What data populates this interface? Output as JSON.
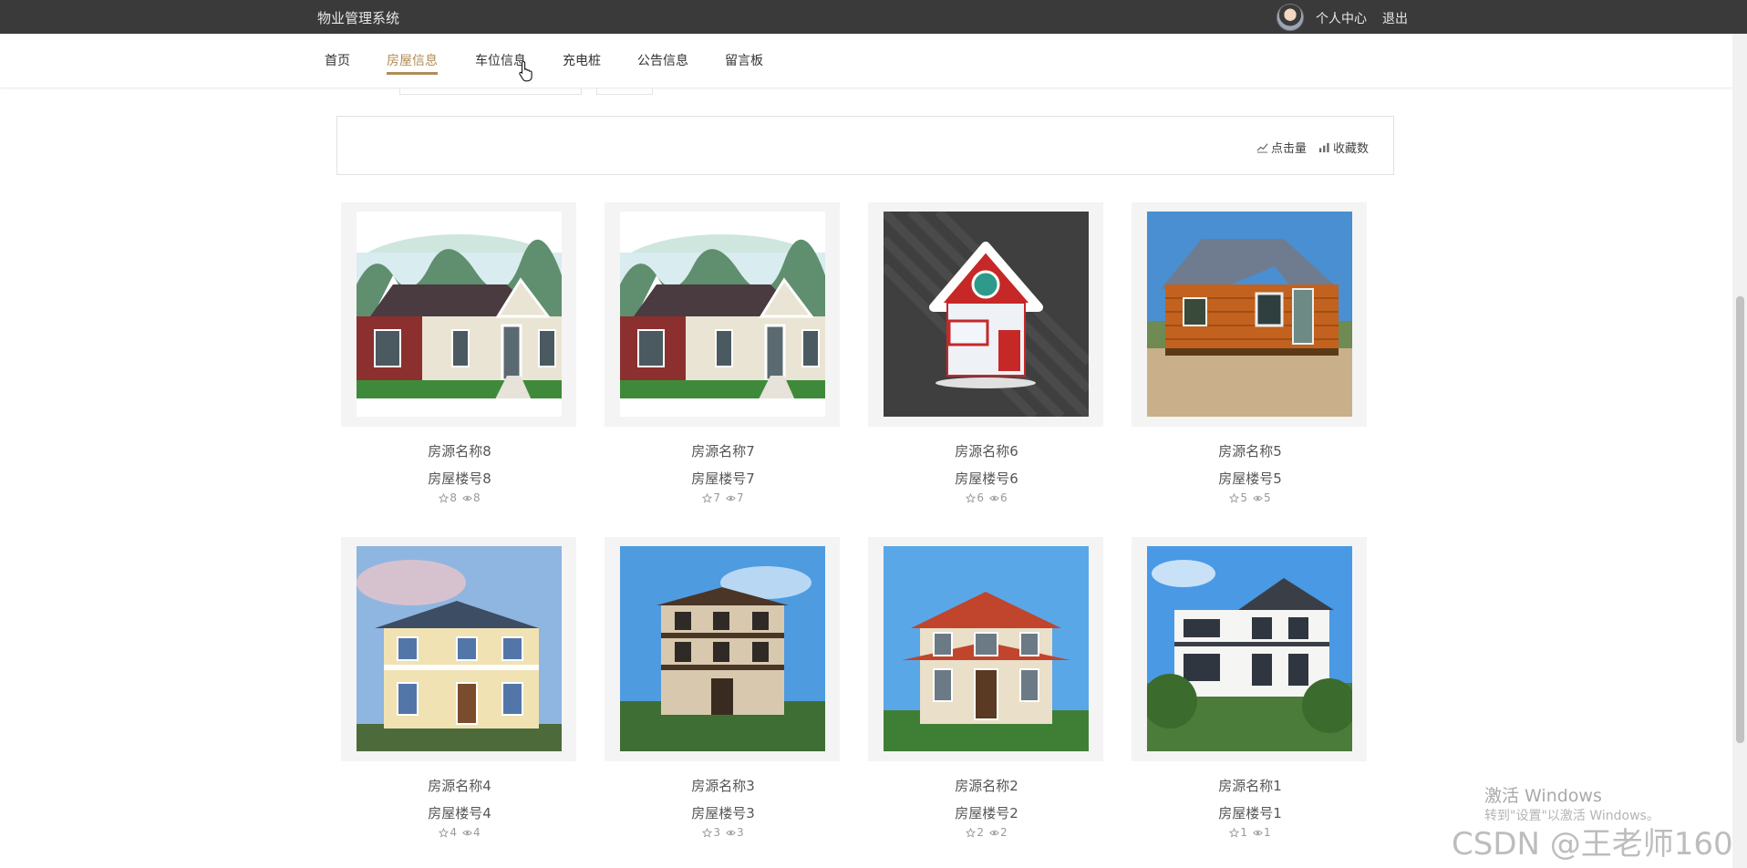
{
  "header": {
    "brand": "物业管理系统",
    "user_center": "个人中心",
    "logout": "退出"
  },
  "nav": {
    "items": [
      {
        "label": "首页"
      },
      {
        "label": "房屋信息"
      },
      {
        "label": "车位信息"
      },
      {
        "label": "充电桩"
      },
      {
        "label": "公告信息"
      },
      {
        "label": "留言板"
      }
    ],
    "active": "房屋信息"
  },
  "sort": {
    "clicks_label": "点击量",
    "favorites_label": "收藏数"
  },
  "listings": [
    {
      "name": "房源名称8",
      "code": "房屋楼号8",
      "favorites": "8",
      "views": "8",
      "image": "two-story-gable-house-icon"
    },
    {
      "name": "房源名称7",
      "code": "房屋楼号7",
      "favorites": "7",
      "views": "7",
      "image": "two-story-gable-house-icon"
    },
    {
      "name": "房源名称6",
      "code": "房屋楼号6",
      "favorites": "6",
      "views": "6",
      "image": "cartoon-house-icon"
    },
    {
      "name": "房源名称5",
      "code": "房屋楼号5",
      "favorites": "5",
      "views": "5",
      "image": "prefab-cabin-icon"
    },
    {
      "name": "房源名称4",
      "code": "房屋楼号4",
      "favorites": "4",
      "views": "4",
      "image": "villa-icon"
    },
    {
      "name": "房源名称3",
      "code": "房屋楼号3",
      "favorites": "3",
      "views": "3",
      "image": "villa-icon"
    },
    {
      "name": "房源名称2",
      "code": "房屋楼号2",
      "favorites": "2",
      "views": "2",
      "image": "villa-icon"
    },
    {
      "name": "房源名称1",
      "code": "房屋楼号1",
      "favorites": "1",
      "views": "1",
      "image": "villa-icon"
    }
  ],
  "overlay": {
    "activate_title": "激活 Windows",
    "activate_sub": "转到\"设置\"以激活 Windows。",
    "watermark": "CSDN @王老师160"
  },
  "colors": {
    "topbar": "#3a3a3a",
    "accent": "#b08d57"
  }
}
